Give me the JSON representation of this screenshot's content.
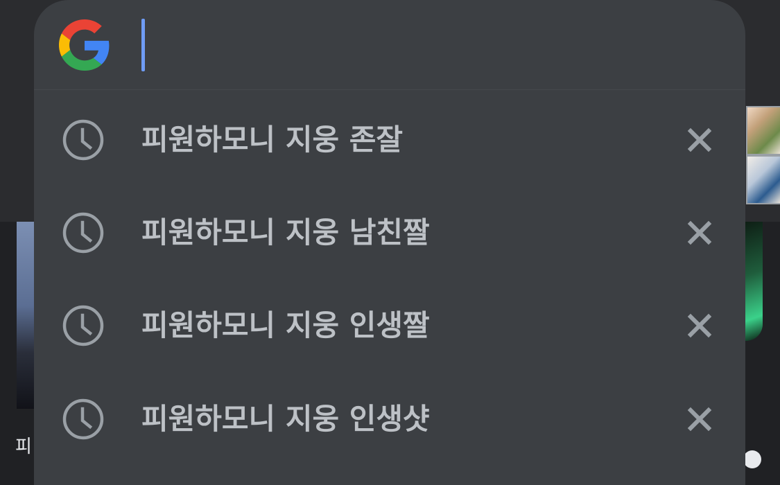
{
  "search": {
    "value": "",
    "placeholder": ""
  },
  "suggestions": [
    {
      "label": "피원하모니 지웅 존잘",
      "icon": "history-clock-icon",
      "remove_icon": "close-icon"
    },
    {
      "label": "피원하모니 지웅 남친짤",
      "icon": "history-clock-icon",
      "remove_icon": "close-icon"
    },
    {
      "label": "피원하모니 지웅 인생짤",
      "icon": "history-clock-icon",
      "remove_icon": "close-icon"
    },
    {
      "label": "피원하모니 지웅 인생샷",
      "icon": "history-clock-icon",
      "remove_icon": "close-icon"
    }
  ],
  "background": {
    "partial_caption": "피"
  },
  "colors": {
    "dropdown_bg": "#3c3f43",
    "page_bg": "#202124",
    "text": "#bdc1c6",
    "cursor": "#6f9cf5",
    "icon": "#9aa0a6"
  }
}
